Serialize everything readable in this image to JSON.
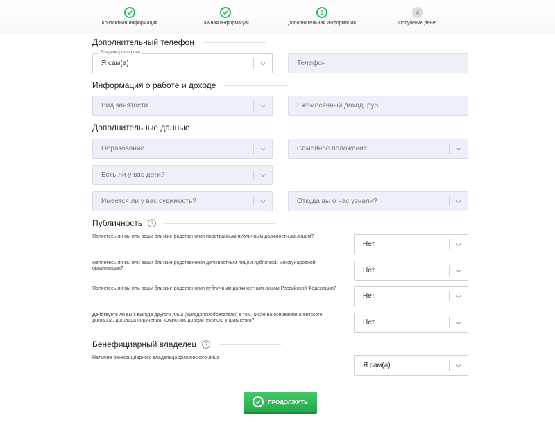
{
  "steps": [
    {
      "label": "Контактная информация",
      "state": "done"
    },
    {
      "label": "Личная информация",
      "state": "done"
    },
    {
      "label": "Дополнительная информация",
      "state": "current",
      "number": "3"
    },
    {
      "label": "Получение денег",
      "state": "todo",
      "number": "4"
    }
  ],
  "sections": {
    "phone": "Дополнительный телефон",
    "work": "Информация о работе и доходе",
    "extra": "Дополнительные данные",
    "publicity": "Публичность",
    "beneficiary": "Бенефициарный владелец"
  },
  "fields": {
    "phone_owner_label": "Владелец телефона",
    "phone_owner_value": "Я сам(а)",
    "phone_placeholder": "Телефон",
    "employment": "Вид занятости",
    "income": "Ежемесячный доход, руб.",
    "education": "Образование",
    "marital": "Семейное положение",
    "children": "Есть ли у вас дети?",
    "conviction": "Имеется ли у вас судимость?",
    "source": "Откуда вы о нас узнали?"
  },
  "publicity_questions": [
    {
      "text": "Являетесь ли вы или ваши близкие родственники иностранным публичным должностным лицом?",
      "value": "Нет"
    },
    {
      "text": "Являетесь ли вы или ваши близкие родственники должностным лицом публичной международной организации?",
      "value": "Нет"
    },
    {
      "text": "Являетесь ли вы или ваши близкие родственники публичным должностным лицом Российской Федерации?",
      "value": "Нет"
    },
    {
      "text": "Действуете ли вы к выгоде другого лица (выгодоприобретателя) в том числе на основании агентского договора, договора поручения, комиссии, доверительного управления?",
      "value": "Нет"
    }
  ],
  "beneficiary": {
    "text": "Наличие бенефициарного владельца физического лица",
    "value": "Я сам(а)"
  },
  "help_mark": "?",
  "continue_label": "ПРОДОЛЖИТЬ",
  "colors": {
    "accent": "#2eb85c",
    "field_bg": "#edf0f9"
  }
}
